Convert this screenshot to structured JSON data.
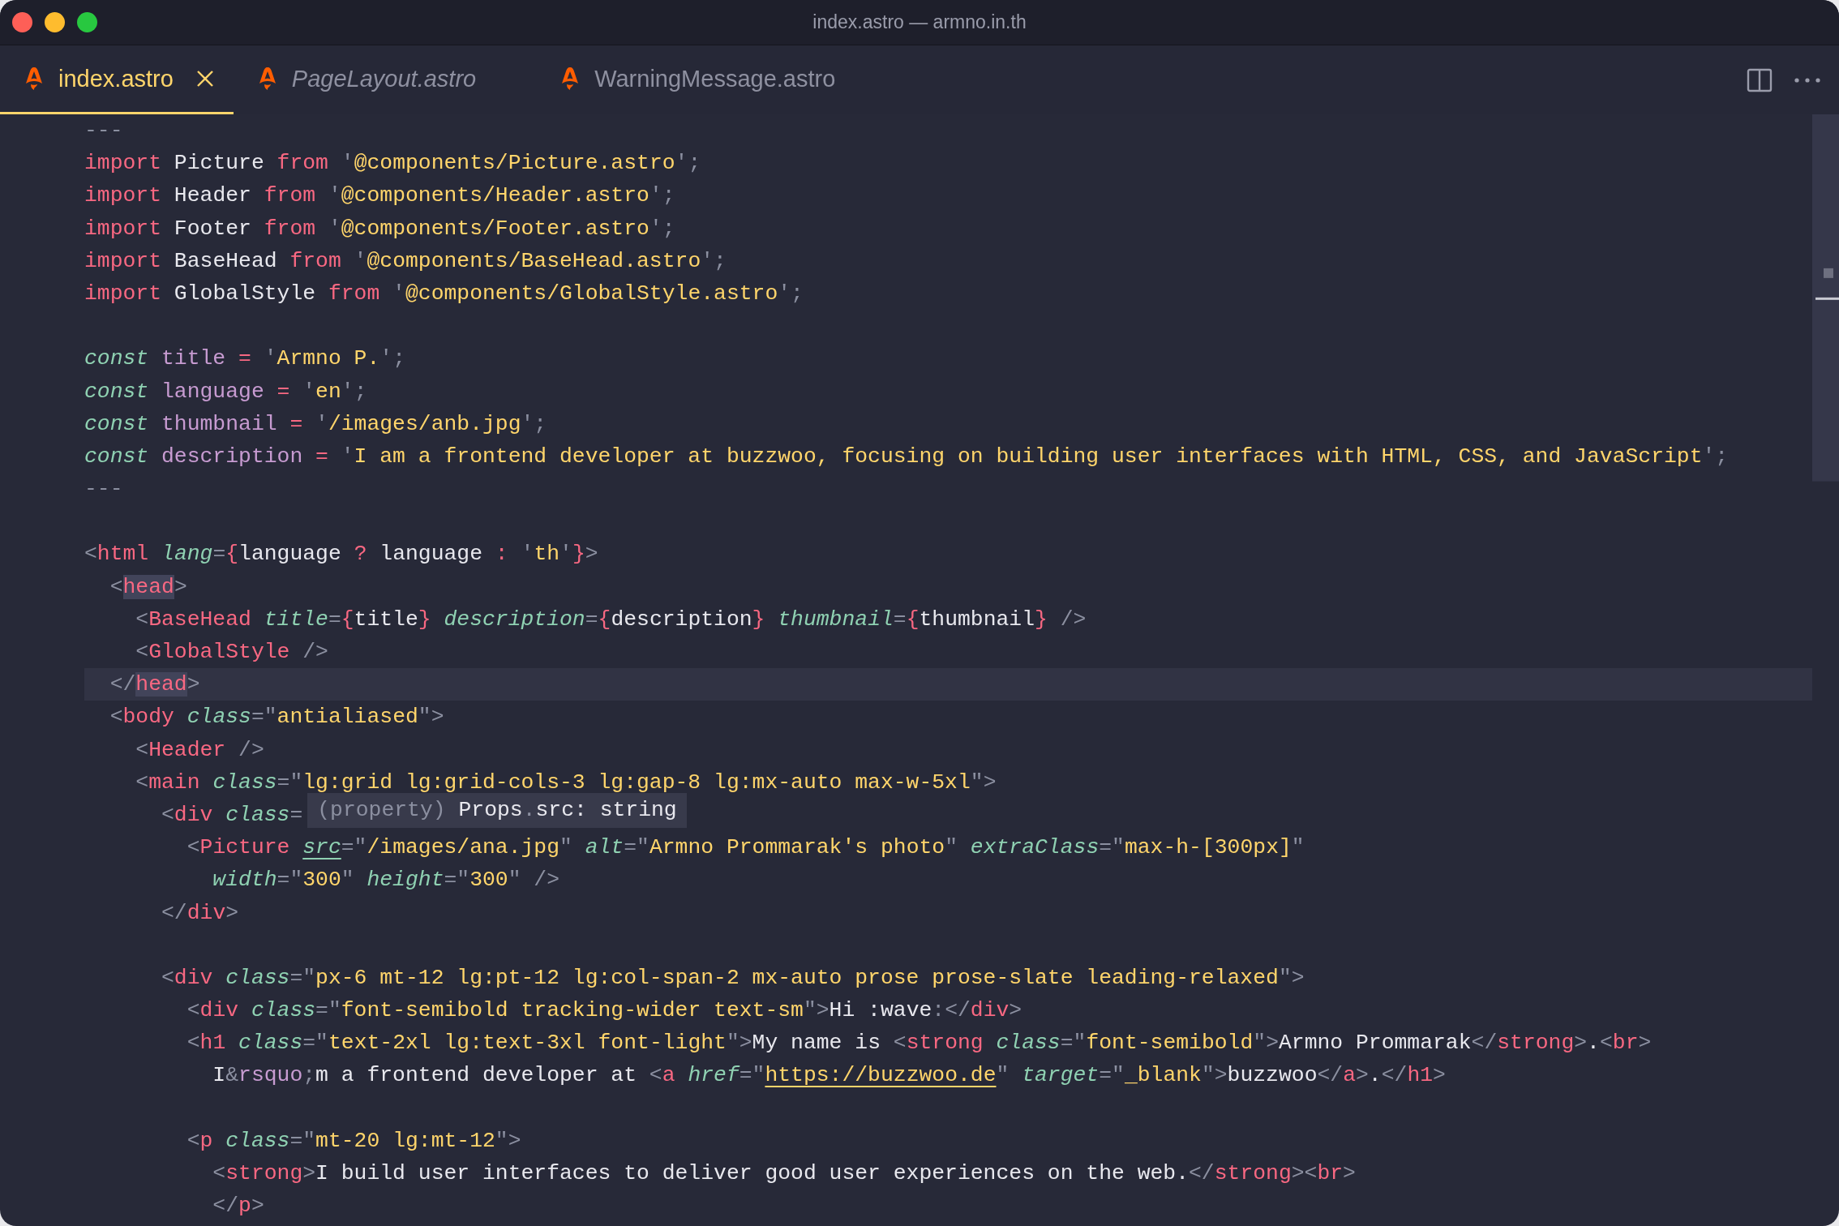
{
  "window": {
    "title": "index.astro — armno.in.th"
  },
  "tabs": [
    {
      "label": "index.astro",
      "selected": true,
      "preview": false
    },
    {
      "label": "PageLayout.astro",
      "selected": false,
      "preview": true
    },
    {
      "label": "WarningMessage.astro",
      "selected": false,
      "preview": false
    }
  ],
  "editor": {
    "lines": [
      {
        "kind": "code",
        "current": false,
        "tokens": [
          {
            "kind": "fence",
            "text": "---"
          }
        ]
      },
      {
        "kind": "code",
        "current": false,
        "tokens": [
          {
            "kind": "kw",
            "text": "import"
          },
          {
            "kind": "plain",
            "text": " Picture "
          },
          {
            "kind": "kw",
            "text": "from"
          },
          {
            "kind": "punct",
            "text": " '"
          },
          {
            "kind": "str",
            "text": "@components/Picture.astro"
          },
          {
            "kind": "punct",
            "text": "';"
          }
        ]
      },
      {
        "kind": "code",
        "current": false,
        "tokens": [
          {
            "kind": "kw",
            "text": "import"
          },
          {
            "kind": "plain",
            "text": " Header "
          },
          {
            "kind": "kw",
            "text": "from"
          },
          {
            "kind": "punct",
            "text": " '"
          },
          {
            "kind": "str",
            "text": "@components/Header.astro"
          },
          {
            "kind": "punct",
            "text": "';"
          }
        ]
      },
      {
        "kind": "code",
        "current": false,
        "tokens": [
          {
            "kind": "kw",
            "text": "import"
          },
          {
            "kind": "plain",
            "text": " Footer "
          },
          {
            "kind": "kw",
            "text": "from"
          },
          {
            "kind": "punct",
            "text": " '"
          },
          {
            "kind": "str",
            "text": "@components/Footer.astro"
          },
          {
            "kind": "punct",
            "text": "';"
          }
        ]
      },
      {
        "kind": "code",
        "current": false,
        "tokens": [
          {
            "kind": "kw",
            "text": "import"
          },
          {
            "kind": "plain",
            "text": " BaseHead "
          },
          {
            "kind": "kw",
            "text": "from"
          },
          {
            "kind": "punct",
            "text": " '"
          },
          {
            "kind": "str",
            "text": "@components/BaseHead.astro"
          },
          {
            "kind": "punct",
            "text": "';"
          }
        ]
      },
      {
        "kind": "code",
        "current": false,
        "tokens": [
          {
            "kind": "kw",
            "text": "import"
          },
          {
            "kind": "plain",
            "text": " GlobalStyle "
          },
          {
            "kind": "kw",
            "text": "from"
          },
          {
            "kind": "punct",
            "text": " '"
          },
          {
            "kind": "str",
            "text": "@components/GlobalStyle.astro"
          },
          {
            "kind": "punct",
            "text": "';"
          }
        ]
      },
      {
        "kind": "blank",
        "current": false
      },
      {
        "kind": "code",
        "current": false,
        "tokens": [
          {
            "kind": "storage",
            "text": "const"
          },
          {
            "kind": "var",
            "text": " title"
          },
          {
            "kind": "op",
            "text": " ="
          },
          {
            "kind": "punct",
            "text": " '"
          },
          {
            "kind": "str",
            "text": "Armno P."
          },
          {
            "kind": "punct",
            "text": "';"
          }
        ]
      },
      {
        "kind": "code",
        "current": false,
        "tokens": [
          {
            "kind": "storage",
            "text": "const"
          },
          {
            "kind": "var",
            "text": " language"
          },
          {
            "kind": "op",
            "text": " ="
          },
          {
            "kind": "punct",
            "text": " '"
          },
          {
            "kind": "str",
            "text": "en"
          },
          {
            "kind": "punct",
            "text": "';"
          }
        ]
      },
      {
        "kind": "code",
        "current": false,
        "tokens": [
          {
            "kind": "storage",
            "text": "const"
          },
          {
            "kind": "var",
            "text": " thumbnail"
          },
          {
            "kind": "op",
            "text": " ="
          },
          {
            "kind": "punct",
            "text": " '"
          },
          {
            "kind": "str",
            "text": "/images/anb.jpg"
          },
          {
            "kind": "punct",
            "text": "';"
          }
        ]
      },
      {
        "kind": "code",
        "current": false,
        "tokens": [
          {
            "kind": "storage",
            "text": "const"
          },
          {
            "kind": "var",
            "text": " description"
          },
          {
            "kind": "op",
            "text": " ="
          },
          {
            "kind": "punct",
            "text": " '"
          },
          {
            "kind": "str",
            "text": "I am a frontend developer at buzzwoo, focusing on building user interfaces with HTML, CSS, and JavaScript"
          },
          {
            "kind": "punct",
            "text": "';"
          }
        ]
      },
      {
        "kind": "code",
        "current": false,
        "tokens": [
          {
            "kind": "fence",
            "text": "---"
          }
        ]
      },
      {
        "kind": "blank",
        "current": false
      },
      {
        "kind": "code",
        "current": false,
        "tokens": [
          {
            "kind": "punct",
            "text": "<"
          },
          {
            "kind": "tag",
            "text": "html"
          },
          {
            "kind": "attr",
            "text": " lang"
          },
          {
            "kind": "punct",
            "text": "="
          },
          {
            "kind": "brace",
            "text": "{"
          },
          {
            "kind": "plain",
            "text": "language "
          },
          {
            "kind": "op",
            "text": "?"
          },
          {
            "kind": "plain",
            "text": " language "
          },
          {
            "kind": "op",
            "text": ":"
          },
          {
            "kind": "punct",
            "text": " '"
          },
          {
            "kind": "str",
            "text": "th"
          },
          {
            "kind": "punct",
            "text": "'"
          },
          {
            "kind": "brace",
            "text": "}"
          },
          {
            "kind": "punct",
            "text": ">"
          }
        ]
      },
      {
        "kind": "code",
        "current": false,
        "tokens": [
          {
            "kind": "punct",
            "text": "  <"
          },
          {
            "kind": "match",
            "text": "head"
          },
          {
            "kind": "punct",
            "text": ">"
          }
        ]
      },
      {
        "kind": "code",
        "current": false,
        "tokens": [
          {
            "kind": "punct",
            "text": "    <"
          },
          {
            "kind": "tag",
            "text": "BaseHead"
          },
          {
            "kind": "attr",
            "text": " title"
          },
          {
            "kind": "punct",
            "text": "="
          },
          {
            "kind": "brace",
            "text": "{"
          },
          {
            "kind": "plain",
            "text": "title"
          },
          {
            "kind": "brace",
            "text": "}"
          },
          {
            "kind": "attr",
            "text": " description"
          },
          {
            "kind": "punct",
            "text": "="
          },
          {
            "kind": "brace",
            "text": "{"
          },
          {
            "kind": "plain",
            "text": "description"
          },
          {
            "kind": "brace",
            "text": "}"
          },
          {
            "kind": "attr",
            "text": " thumbnail"
          },
          {
            "kind": "punct",
            "text": "="
          },
          {
            "kind": "brace",
            "text": "{"
          },
          {
            "kind": "plain",
            "text": "thumbnail"
          },
          {
            "kind": "brace",
            "text": "}"
          },
          {
            "kind": "punct",
            "text": " />"
          }
        ]
      },
      {
        "kind": "code",
        "current": false,
        "tokens": [
          {
            "kind": "punct",
            "text": "    <"
          },
          {
            "kind": "tag",
            "text": "GlobalStyle"
          },
          {
            "kind": "punct",
            "text": " />"
          }
        ]
      },
      {
        "kind": "code",
        "current": true,
        "tokens": [
          {
            "kind": "punct",
            "text": "  </"
          },
          {
            "kind": "match",
            "text": "head"
          },
          {
            "kind": "punct",
            "text": ">"
          }
        ]
      },
      {
        "kind": "code",
        "current": false,
        "tokens": [
          {
            "kind": "punct",
            "text": "  <"
          },
          {
            "kind": "tag",
            "text": "body"
          },
          {
            "kind": "attr",
            "text": " class"
          },
          {
            "kind": "punct",
            "text": "=\""
          },
          {
            "kind": "str",
            "text": "antialiased"
          },
          {
            "kind": "punct",
            "text": "\">"
          }
        ]
      },
      {
        "kind": "code",
        "current": false,
        "tokens": [
          {
            "kind": "punct",
            "text": "    <"
          },
          {
            "kind": "tag",
            "text": "Header"
          },
          {
            "kind": "punct",
            "text": " />"
          }
        ]
      },
      {
        "kind": "code",
        "current": false,
        "tokens": [
          {
            "kind": "punct",
            "text": "    <"
          },
          {
            "kind": "tag",
            "text": "main"
          },
          {
            "kind": "attr",
            "text": " class"
          },
          {
            "kind": "punct",
            "text": "=\""
          },
          {
            "kind": "str",
            "text": "lg:grid lg:grid-cols-3 lg:gap-8 lg:mx-auto max-w-5xl"
          },
          {
            "kind": "punct",
            "text": "\">"
          }
        ]
      },
      {
        "kind": "code",
        "current": false,
        "tokens": [
          {
            "kind": "punct",
            "text": "      <"
          },
          {
            "kind": "tag",
            "text": "div"
          },
          {
            "kind": "attr",
            "text": " class"
          },
          {
            "kind": "punct",
            "text": "="
          }
        ],
        "tooltip": [
          {
            "kind": "punct",
            "text": "(property)"
          },
          {
            "kind": "plain",
            "text": " Props"
          },
          {
            "kind": "punct",
            "text": "."
          },
          {
            "kind": "plain",
            "text": "src: string"
          }
        ]
      },
      {
        "kind": "code",
        "current": false,
        "tokens": [
          {
            "kind": "punct",
            "text": "        <"
          },
          {
            "kind": "tag",
            "text": "Picture "
          },
          {
            "kind": "hover",
            "text": "src"
          },
          {
            "kind": "punct",
            "text": "=\""
          },
          {
            "kind": "str",
            "text": "/images/ana.jpg"
          },
          {
            "kind": "punct",
            "text": "\""
          },
          {
            "kind": "attr",
            "text": " alt"
          },
          {
            "kind": "punct",
            "text": "=\""
          },
          {
            "kind": "str",
            "text": "Armno Prommarak's photo"
          },
          {
            "kind": "punct",
            "text": "\""
          },
          {
            "kind": "attr",
            "text": " extraClass"
          },
          {
            "kind": "punct",
            "text": "=\""
          },
          {
            "kind": "str",
            "text": "max-h-[300px]"
          },
          {
            "kind": "punct",
            "text": "\""
          }
        ]
      },
      {
        "kind": "code",
        "current": false,
        "tokens": [
          {
            "kind": "attr",
            "text": "          width"
          },
          {
            "kind": "punct",
            "text": "=\""
          },
          {
            "kind": "str",
            "text": "300"
          },
          {
            "kind": "punct",
            "text": "\""
          },
          {
            "kind": "attr",
            "text": " height"
          },
          {
            "kind": "punct",
            "text": "=\""
          },
          {
            "kind": "str",
            "text": "300"
          },
          {
            "kind": "punct",
            "text": "\" />"
          }
        ]
      },
      {
        "kind": "code",
        "current": false,
        "tokens": [
          {
            "kind": "punct",
            "text": "      </"
          },
          {
            "kind": "tag",
            "text": "div"
          },
          {
            "kind": "punct",
            "text": ">"
          }
        ]
      },
      {
        "kind": "blank",
        "current": false
      },
      {
        "kind": "code",
        "current": false,
        "tokens": [
          {
            "kind": "punct",
            "text": "      <"
          },
          {
            "kind": "tag",
            "text": "div"
          },
          {
            "kind": "attr",
            "text": " class"
          },
          {
            "kind": "punct",
            "text": "=\""
          },
          {
            "kind": "str",
            "text": "px-6 mt-12 lg:pt-12 lg:col-span-2 mx-auto prose prose-slate leading-relaxed"
          },
          {
            "kind": "punct",
            "text": "\">"
          }
        ]
      },
      {
        "kind": "code",
        "current": false,
        "tokens": [
          {
            "kind": "punct",
            "text": "        <"
          },
          {
            "kind": "tag",
            "text": "div"
          },
          {
            "kind": "attr",
            "text": " class"
          },
          {
            "kind": "punct",
            "text": "=\""
          },
          {
            "kind": "str",
            "text": "font-semibold tracking-wider text-sm"
          },
          {
            "kind": "punct",
            "text": "\">"
          },
          {
            "kind": "plain",
            "text": "Hi :wave"
          },
          {
            "kind": "punct",
            "text": ":</"
          },
          {
            "kind": "tag",
            "text": "div"
          },
          {
            "kind": "punct",
            "text": ">"
          }
        ]
      },
      {
        "kind": "code",
        "current": false,
        "tokens": [
          {
            "kind": "punct",
            "text": "        <"
          },
          {
            "kind": "tag",
            "text": "h1"
          },
          {
            "kind": "attr",
            "text": " class"
          },
          {
            "kind": "punct",
            "text": "=\""
          },
          {
            "kind": "str",
            "text": "text-2xl lg:text-3xl font-light"
          },
          {
            "kind": "punct",
            "text": "\">"
          },
          {
            "kind": "plain",
            "text": "My name is "
          },
          {
            "kind": "punct",
            "text": "<"
          },
          {
            "kind": "tag",
            "text": "strong"
          },
          {
            "kind": "attr",
            "text": " class"
          },
          {
            "kind": "punct",
            "text": "=\""
          },
          {
            "kind": "str",
            "text": "font-semibold"
          },
          {
            "kind": "punct",
            "text": "\">"
          },
          {
            "kind": "plain",
            "text": "Armno Prommarak"
          },
          {
            "kind": "punct",
            "text": "</"
          },
          {
            "kind": "tag",
            "text": "strong"
          },
          {
            "kind": "punct",
            "text": ">"
          },
          {
            "kind": "plain",
            "text": "."
          },
          {
            "kind": "punct",
            "text": "<"
          },
          {
            "kind": "tag",
            "text": "br"
          },
          {
            "kind": "punct",
            "text": ">"
          }
        ]
      },
      {
        "kind": "code",
        "current": false,
        "tokens": [
          {
            "kind": "plain",
            "text": "          I"
          },
          {
            "kind": "punct",
            "text": "&"
          },
          {
            "kind": "entity",
            "text": "rsquo"
          },
          {
            "kind": "punct",
            "text": ";"
          },
          {
            "kind": "plain",
            "text": "m a frontend developer at "
          },
          {
            "kind": "punct",
            "text": "<"
          },
          {
            "kind": "tag",
            "text": "a"
          },
          {
            "kind": "attr",
            "text": " href"
          },
          {
            "kind": "punct",
            "text": "=\""
          },
          {
            "kind": "link",
            "text": "https://buzzwoo.de"
          },
          {
            "kind": "punct",
            "text": "\""
          },
          {
            "kind": "attr",
            "text": " target"
          },
          {
            "kind": "punct",
            "text": "=\""
          },
          {
            "kind": "str",
            "text": "_blank"
          },
          {
            "kind": "punct",
            "text": "\">"
          },
          {
            "kind": "plain",
            "text": "buzzwoo"
          },
          {
            "kind": "punct",
            "text": "</"
          },
          {
            "kind": "tag",
            "text": "a"
          },
          {
            "kind": "punct",
            "text": ">"
          },
          {
            "kind": "plain",
            "text": "."
          },
          {
            "kind": "punct",
            "text": "</"
          },
          {
            "kind": "tag",
            "text": "h1"
          },
          {
            "kind": "punct",
            "text": ">"
          }
        ]
      },
      {
        "kind": "blank",
        "current": false
      },
      {
        "kind": "code",
        "current": false,
        "tokens": [
          {
            "kind": "punct",
            "text": "        <"
          },
          {
            "kind": "tag",
            "text": "p"
          },
          {
            "kind": "attr",
            "text": " class"
          },
          {
            "kind": "punct",
            "text": "=\""
          },
          {
            "kind": "str",
            "text": "mt-20 lg:mt-12"
          },
          {
            "kind": "punct",
            "text": "\">"
          }
        ]
      },
      {
        "kind": "code",
        "current": false,
        "tokens": [
          {
            "kind": "punct",
            "text": "          <"
          },
          {
            "kind": "tag",
            "text": "strong"
          },
          {
            "kind": "punct",
            "text": ">"
          },
          {
            "kind": "plain",
            "text": "I build user interfaces to deliver good user experiences on the web."
          },
          {
            "kind": "punct",
            "text": "</"
          },
          {
            "kind": "tag",
            "text": "strong"
          },
          {
            "kind": "punct",
            "text": "><"
          },
          {
            "kind": "tag",
            "text": "br"
          },
          {
            "kind": "punct",
            "text": ">"
          }
        ]
      },
      {
        "kind": "code",
        "current": false,
        "tokens": [
          {
            "kind": "punct",
            "text": "          </"
          },
          {
            "kind": "tag",
            "text": "p"
          },
          {
            "kind": "punct",
            "text": ">"
          }
        ]
      }
    ]
  }
}
